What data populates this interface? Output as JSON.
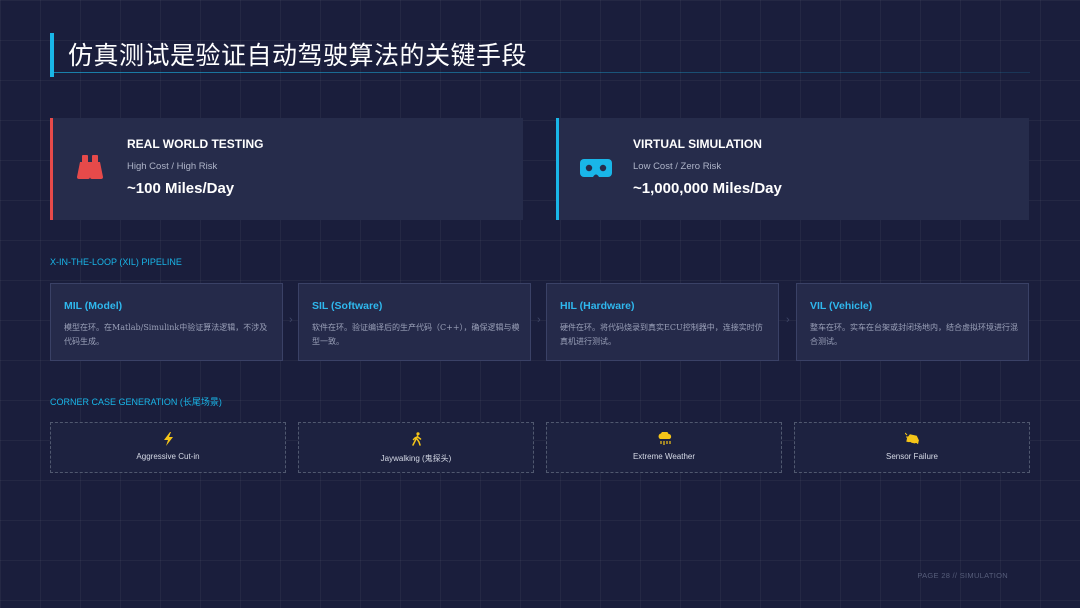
{
  "header": {
    "title": "仿真测试是验证自动驾驶算法的关键手段"
  },
  "comparison": [
    {
      "title": "REAL WORLD TESTING",
      "subtitle": "High Cost / High Risk",
      "value": "~100 Miles/Day",
      "icon": "binoculars-icon",
      "accent": "#e64a4a"
    },
    {
      "title": "VIRTUAL SIMULATION",
      "subtitle": "Low Cost / Zero Risk",
      "value": "~1,000,000 Miles/Day",
      "icon": "vr-headset-icon",
      "accent": "#19b6e8"
    }
  ],
  "pipeline": {
    "label": "X-IN-THE-LOOP (XIL) PIPELINE",
    "stages": [
      {
        "title": "MIL (Model)",
        "desc": "模型在环。在Matlab/Simulink中验证算法逻辑，不涉及代码生成。"
      },
      {
        "title": "SIL (Software)",
        "desc": "软件在环。验证编译后的生产代码（C++），确保逻辑与模型一致。"
      },
      {
        "title": "HIL (Hardware)",
        "desc": "硬件在环。将代码烧录到真实ECU控制器中，连接实时仿真机进行测试。"
      },
      {
        "title": "VIL (Vehicle)",
        "desc": "整车在环。实车在台架或封闭场地内，结合虚拟环境进行混合测试。"
      }
    ]
  },
  "corner_cases": {
    "label": "CORNER CASE GENERATION (长尾场景)",
    "items": [
      {
        "label": "Aggressive Cut-in",
        "icon": "lightning-bolt-icon",
        "color": "#f5c518"
      },
      {
        "label": "Jaywalking (鬼探头)",
        "icon": "walking-person-icon",
        "color": "#f5c518"
      },
      {
        "label": "Extreme Weather",
        "icon": "storm-cloud-icon",
        "color": "#f5c518"
      },
      {
        "label": "Sensor Failure",
        "icon": "car-crash-icon",
        "color": "#f5c518"
      }
    ]
  },
  "footer": {
    "text": "PAGE 28 // SIMULATION"
  }
}
